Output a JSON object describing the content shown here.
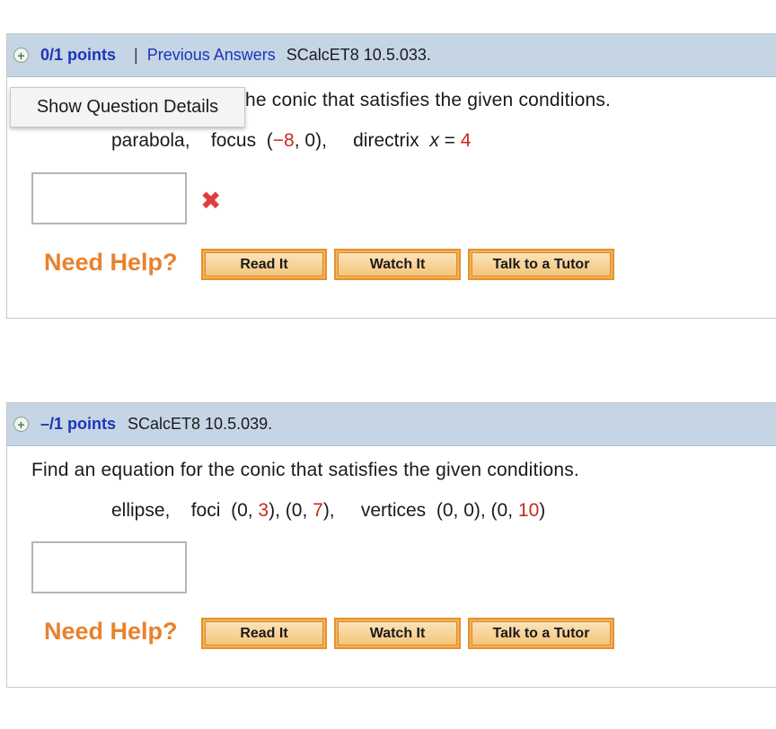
{
  "question1": {
    "points": "0/1 points",
    "separator": "|",
    "previous_answers": "Previous Answers",
    "ref": "SCalcET8 10.5.033.",
    "prompt_visible": "he conic that satisfies the given conditions.",
    "cond_type": "parabola,",
    "focus_label": "focus",
    "focus_open": "(",
    "focus_x": "−8",
    "focus_rest": ", 0),",
    "directrix_label": "directrix",
    "directrix_var": "x",
    "directrix_eq": "=",
    "directrix_val": "4",
    "incorrect_mark": "✖"
  },
  "tooltip": {
    "label": "Show Question Details"
  },
  "question2": {
    "points": "–/1 points",
    "ref": "SCalcET8 10.5.039.",
    "prompt": "Find an equation for the conic that satisfies the given conditions.",
    "cond_type": "ellipse,",
    "foci_label": "foci",
    "foci_a_open": "(0, ",
    "foci_a_val": "3",
    "foci_a_close": "), (0, ",
    "foci_b_val": "7",
    "foci_b_close": "),",
    "vertices_label": "vertices",
    "vertices_a": "(0, 0), (0, ",
    "vertices_b_val": "10",
    "vertices_b_close": ")"
  },
  "help": {
    "label": "Need Help?",
    "read_it": "Read It",
    "watch_it": "Watch It",
    "talk_to_tutor": "Talk to a Tutor"
  },
  "colors": {
    "header_bg": "#c5d5e6",
    "points": "#1d35b8",
    "highlight_red": "#c62a1c",
    "need_help": "#e9812d",
    "button_border": "#e5912f"
  }
}
